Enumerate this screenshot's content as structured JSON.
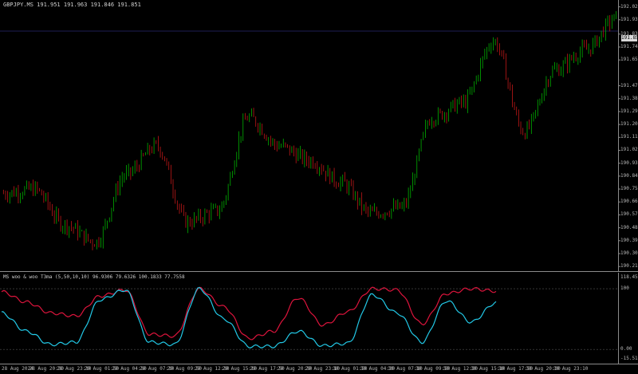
{
  "chart": {
    "title": "GBPJPY.MS  191.951 191.963 191.846 191.851",
    "current_price": "191.851",
    "colors": {
      "bull": "#00b000",
      "bear": "#c01818",
      "grid": "#1e1e55",
      "axis": "#8a8a8a",
      "bg": "#000000"
    },
    "price_labels": [
      "192.020",
      "191.930",
      "191.830",
      "191.740",
      "191.650",
      "191.470",
      "191.380",
      "191.290",
      "191.200",
      "191.110",
      "191.020",
      "190.930",
      "190.840",
      "190.750",
      "190.660",
      "190.570",
      "190.480",
      "190.390",
      "190.300",
      "190.210"
    ],
    "ylim": [
      190.2,
      192.04
    ]
  },
  "indicator": {
    "title": "MS  woo & woo T3ma (5,50,10,10) 96.9306 79.6326 100.1833 77.7558",
    "labels": [
      "118.4519",
      "100",
      "0.00",
      "-15.5153"
    ],
    "colors": {
      "line1": "#dc143c",
      "line2": "#22c8e6"
    }
  },
  "time_axis": {
    "labels": [
      "28 Aug 2024",
      "28 Aug 20:30",
      "28 Aug 23:10",
      "29 Aug 01:50",
      "29 Aug 04:30",
      "29 Aug 07:10",
      "29 Aug 09:50",
      "29 Aug 12:30",
      "29 Aug 15:10",
      "29 Aug 17:50",
      "29 Aug 20:30",
      "29 Aug 23:10",
      "30 Aug 01:50",
      "30 Aug 04:30",
      "30 Aug 07:10",
      "30 Aug 09:50",
      "30 Aug 12:30",
      "30 Aug 15:10",
      "30 Aug 17:50",
      "30 Aug 20:30",
      "30 Aug 23:10"
    ]
  },
  "chart_data": {
    "type": "line",
    "title": "GBPJPY.MS  191.951 191.963 191.846 191.851",
    "xlabel": "",
    "ylabel": "",
    "ylim": [
      190.2,
      192.04
    ],
    "x": [
      "28 Aug 2024",
      "28 Aug 20:30",
      "28 Aug 23:10",
      "29 Aug 01:50",
      "29 Aug 04:30",
      "29 Aug 07:10",
      "29 Aug 09:50",
      "29 Aug 12:30",
      "29 Aug 15:10",
      "29 Aug 17:50",
      "29 Aug 20:30",
      "29 Aug 23:10",
      "30 Aug 01:50",
      "30 Aug 04:30",
      "30 Aug 07:10",
      "30 Aug 09:50",
      "30 Aug 12:30",
      "30 Aug 15:10",
      "30 Aug 17:50",
      "30 Aug 20:30",
      "30 Aug 23:10"
    ],
    "series": [
      {
        "values": [
          190.72,
          190.75,
          190.5,
          190.38,
          190.85,
          191.05,
          190.52,
          190.6,
          191.25,
          191.05,
          190.95,
          190.8,
          190.58,
          190.62,
          191.25,
          191.35,
          191.78,
          191.15,
          191.58,
          191.72,
          191.94
        ]
      }
    ]
  },
  "indicator_data": {
    "ylim": [
      -15.5153,
      118.4519
    ],
    "series": [
      {
        "values": [
          95,
          78,
          60,
          55,
          88,
          98,
          25,
          22,
          100,
          70,
          18,
          30,
          85,
          40,
          62,
          100,
          98,
          42,
          92,
          100,
          96
        ]
      },
      {
        "values": [
          60,
          30,
          8,
          12,
          82,
          98,
          12,
          8,
          100,
          50,
          5,
          5,
          30,
          6,
          10,
          90,
          60,
          12,
          80,
          45,
          77
        ]
      }
    ]
  }
}
